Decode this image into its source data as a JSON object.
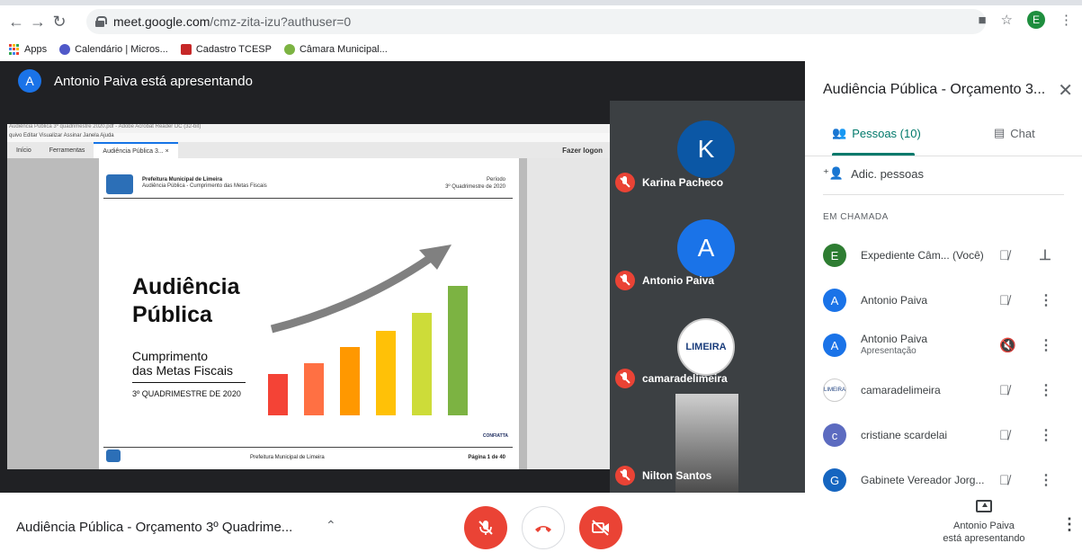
{
  "browser": {
    "url_host": "meet.google.com",
    "url_path": "/cmz-zita-izu?authuser=0",
    "profile_initial": "E",
    "bookmarks": [
      {
        "label": "Apps"
      },
      {
        "label": "Calendário | Micros..."
      },
      {
        "label": "Cadastro TCESP"
      },
      {
        "label": "Câmara Municipal..."
      }
    ]
  },
  "presenter_bar": {
    "avatar_initial": "A",
    "text": "Antonio Paiva está apresentando"
  },
  "shared_screen": {
    "acrobat_title": "Audiência Pública 3º quadrimestre 2020.pdf - Adobe Acrobat Reader DC (32-bit)",
    "acrobat_menu": "quivo  Editar  Visualizar  Assinar  Janela  Ajuda",
    "tabs": [
      "Início",
      "Ferramentas",
      "Audiência Pública 3... ×"
    ],
    "logon": "Fazer logon",
    "pdf": {
      "org": "Prefeitura Municipal de Limeira",
      "subtitle": "Audiência Pública - Cumprimento das Metas Fiscais",
      "periodo_label": "Período",
      "periodo_value": "3º Quadrimestre de 2020",
      "title_line1": "Audiência",
      "title_line2": "Pública",
      "cump_line1": "Cumprimento",
      "cump_line2": "das Metas Fiscais",
      "quad": "3º QUADRIMESTRE DE 2020",
      "brand": "CONFIATTA",
      "footer_center": "Prefeitura Municipal de Limeira",
      "footer_page": "Página 1 de 40"
    }
  },
  "tiles": [
    {
      "name": "Karina Pacheco",
      "initial": "K",
      "color": "#0b57a5"
    },
    {
      "name": "Antonio Paiva",
      "initial": "A",
      "color": "#1a73e8"
    },
    {
      "name": "camaradelimeira",
      "logo_text": "LIMEIRA"
    },
    {
      "name": "Nilton Santos"
    }
  ],
  "panel": {
    "title": "Audiência Pública - Orçamento 3...",
    "tab_people": "Pessoas (10)",
    "tab_chat": "Chat",
    "add_people": "Adic. pessoas",
    "section": "EM CHAMADA",
    "participants": [
      {
        "initial": "E",
        "name": "Expediente Câm...  (Você)",
        "sub": "",
        "color": "#2e7d32"
      },
      {
        "initial": "A",
        "name": "Antonio Paiva",
        "sub": "",
        "color": "#1a73e8"
      },
      {
        "initial": "A",
        "name": "Antonio Paiva",
        "sub": "Apresentação",
        "color": "#1a73e8"
      },
      {
        "initial": "",
        "name": "camaradelimeira",
        "sub": "",
        "color": "#ffffff"
      },
      {
        "initial": "c",
        "name": "cristiane scardelai",
        "sub": "",
        "color": "#5c6bc0"
      },
      {
        "initial": "G",
        "name": "Gabinete Vereador Jorg...",
        "sub": "",
        "color": "#1565c0"
      }
    ]
  },
  "bottom": {
    "meeting_title": "Audiência Pública - Orçamento 3º Quadrime...",
    "present_line1": "Antonio Paiva",
    "present_line2": "está apresentando"
  },
  "colors": {
    "meet_red": "#ea4335",
    "meet_teal": "#00796b",
    "stage_bg": "#202124"
  }
}
